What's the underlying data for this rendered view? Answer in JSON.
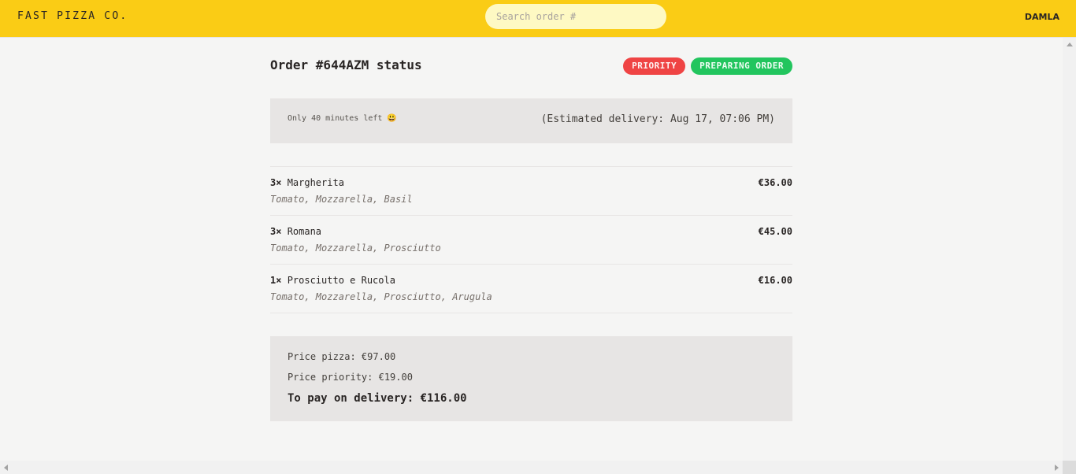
{
  "header": {
    "brand": "FAST PIZZA CO.",
    "search_placeholder": "Search order #",
    "username": "DAMLA"
  },
  "order": {
    "title": "Order #644AZM status",
    "badges": {
      "priority": "PRIORITY",
      "status": "PREPARING ORDER"
    },
    "eta": {
      "minutes_left": "Only 40 minutes left 😃",
      "estimated_delivery": "(Estimated delivery: Aug 17, 07:06 PM)"
    },
    "items": [
      {
        "qty": "3×",
        "name": "Margherita",
        "price": "€36.00",
        "ingredients": "Tomato, Mozzarella, Basil"
      },
      {
        "qty": "3×",
        "name": "Romana",
        "price": "€45.00",
        "ingredients": "Tomato, Mozzarella, Prosciutto"
      },
      {
        "qty": "1×",
        "name": "Prosciutto e Rucola",
        "price": "€16.00",
        "ingredients": "Tomato, Mozzarella, Prosciutto, Arugula"
      }
    ],
    "summary": {
      "price_pizza": "Price pizza: €97.00",
      "price_priority": "Price priority: €19.00",
      "to_pay": "To pay on delivery: €116.00"
    }
  },
  "colors": {
    "header_bg": "#facc15",
    "priority_badge": "#ef4444",
    "status_badge": "#22c55e",
    "panel_bg": "#e7e5e4",
    "page_bg": "#f5f5f4"
  }
}
